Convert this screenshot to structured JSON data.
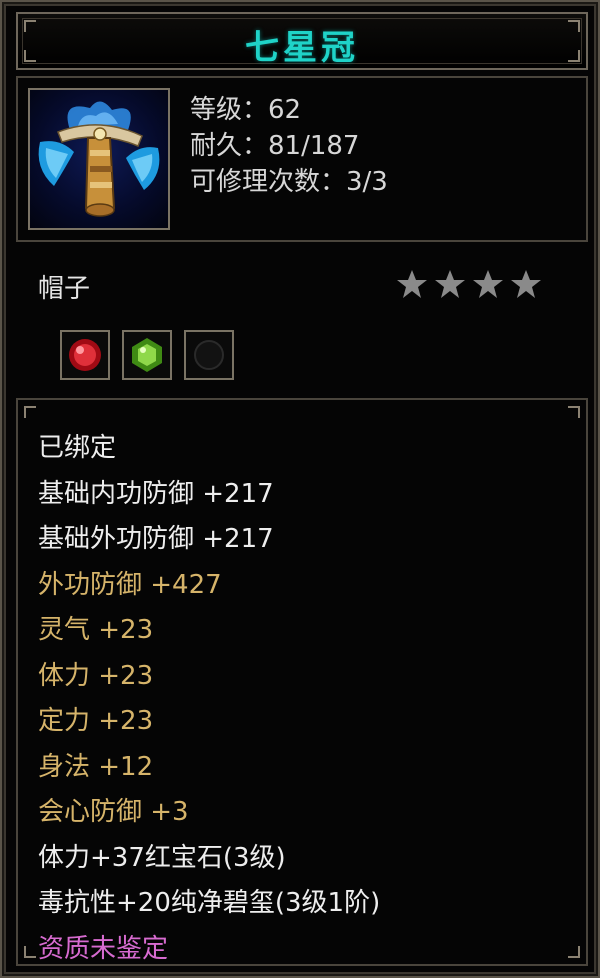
{
  "item": {
    "name": "七星冠",
    "level_line": "等级：62",
    "durability_line": "耐久：81/187",
    "repair_line": "可修理次数：3/3",
    "type": "帽子",
    "stars": {
      "filled": 0,
      "total": 4
    },
    "sockets": [
      {
        "gem": "ruby",
        "color": "#c8141e"
      },
      {
        "gem": "jade",
        "color": "#5fb82a"
      },
      {
        "gem": "empty",
        "color": "#111111"
      }
    ]
  },
  "attributes": [
    {
      "text": "已绑定",
      "color": "white"
    },
    {
      "text": "基础内功防御 +217",
      "color": "white"
    },
    {
      "text": "基础外功防御 +217",
      "color": "white"
    },
    {
      "text": "外功防御 +427",
      "color": "gold"
    },
    {
      "text": "灵气 +23",
      "color": "gold"
    },
    {
      "text": "体力 +23",
      "color": "gold"
    },
    {
      "text": "定力 +23",
      "color": "gold"
    },
    {
      "text": "身法 +12",
      "color": "gold"
    },
    {
      "text": "会心防御 +3",
      "color": "gold"
    },
    {
      "text": "体力+37红宝石(3级)",
      "color": "white"
    },
    {
      "text": "毒抗性+20纯净碧玺(3级1阶)",
      "color": "white"
    },
    {
      "text": "资质未鉴定",
      "color": "pink"
    }
  ],
  "colors": {
    "title": "#1fd3c8",
    "white_text": "#eeeeee",
    "gold_text": "#d6b46a",
    "pink_text": "#d76bd0",
    "star_empty": "#8a8a8a",
    "frame": "#6e675b"
  }
}
